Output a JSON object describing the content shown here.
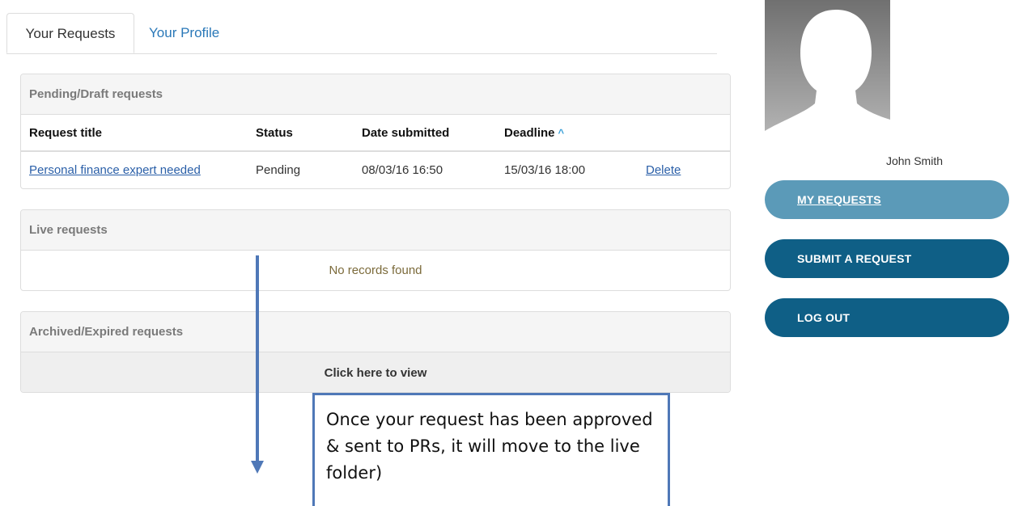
{
  "tabs": [
    {
      "label": "Your Requests",
      "active": true
    },
    {
      "label": "Your Profile",
      "active": false
    }
  ],
  "pending": {
    "heading": "Pending/Draft requests",
    "columns": [
      "Request title",
      "Status",
      "Date submitted",
      "Deadline"
    ],
    "sort_indicator": "^",
    "rows": [
      {
        "title": "Personal finance expert needed",
        "status": "Pending",
        "date_submitted": "08/03/16 16:50",
        "deadline": "15/03/16 18:00",
        "action": "Delete"
      }
    ]
  },
  "live": {
    "heading": "Live requests",
    "empty_text": "No records found"
  },
  "archived": {
    "heading": "Archived/Expired requests",
    "view_text": "Click here to view"
  },
  "sidebar": {
    "user_name": "John Smith",
    "buttons": [
      {
        "label": "MY REQUESTS",
        "active": true
      },
      {
        "label": "SUBMIT A REQUEST",
        "active": false
      },
      {
        "label": "LOG OUT",
        "active": false
      }
    ]
  },
  "annotation": {
    "text": "Once your request has been approved & sent to PRs, it will move to the live folder)"
  },
  "colors": {
    "tab_link": "#2a78b8",
    "button_active": "#5b9ab8",
    "button": "#0f5f86",
    "annotation": "#4f78b7"
  },
  "icons": {
    "sort": "caret-up-icon",
    "avatar": "user-silhouette",
    "arrow": "arrow-down"
  }
}
